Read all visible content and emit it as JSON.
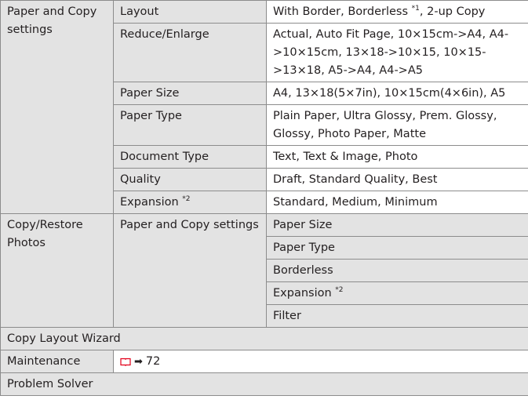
{
  "rows": {
    "paper_copy": {
      "group": "Paper and Copy settings",
      "layout": {
        "label": "Layout",
        "value": "With Border, Borderless ",
        "sup": "*1",
        "tail": ", 2-up Copy"
      },
      "reduce": {
        "label": "Reduce/Enlarge",
        "value": "Actual, Auto Fit Page, 10×15cm->A4, A4->10×15cm, 13×18->10×15, 10×15->13×18, A5->A4, A4->A5"
      },
      "paper_size": {
        "label": "Paper Size",
        "value": "A4, 13×18(5×7in), 10×15cm(4×6in), A5"
      },
      "paper_type": {
        "label": "Paper Type",
        "value": "Plain Paper, Ultra Glossy, Prem. Glossy, Glossy, Photo Paper, Matte"
      },
      "document_type": {
        "label": "Document Type",
        "value": "Text, Text & Image, Photo"
      },
      "quality": {
        "label": "Quality",
        "value": "Draft, Standard Quality, Best"
      },
      "expansion": {
        "label": "Expansion ",
        "sup": "*2",
        "value": "Standard, Medium, Minimum"
      }
    },
    "copy_restore": {
      "group": "Copy/Restore Photos",
      "sub": "Paper and Copy settings",
      "items": {
        "paper_size": "Paper Size",
        "paper_type": "Paper Type",
        "borderless": "Borderless",
        "expansion": "Expansion ",
        "expansion_sup": "*2",
        "filter": "Filter"
      }
    },
    "wizard": {
      "label": "Copy Layout Wizard"
    },
    "maintenance": {
      "label": "Maintenance",
      "page_ref": "72",
      "book_icon": "book-icon",
      "arrow_icon": "right-arrow-icon"
    },
    "problem_solver": {
      "label": "Problem Solver"
    }
  },
  "colors": {
    "header_fill": "#e3e3e3",
    "border": "#8c8c8c",
    "text": "#231f20",
    "icon_red": "#e2001a"
  }
}
